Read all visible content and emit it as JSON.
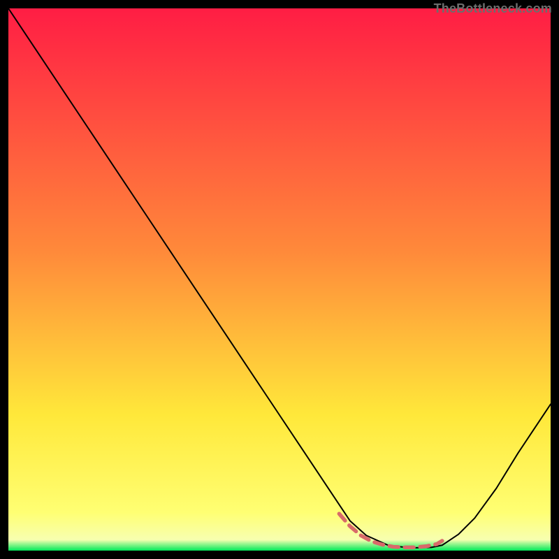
{
  "credit": {
    "text": "TheBottleneck.com"
  },
  "chart_data": {
    "type": "line",
    "title": "",
    "xlabel": "",
    "ylabel": "",
    "xlim": [
      0,
      100
    ],
    "ylim": [
      0,
      100
    ],
    "background_gradient": {
      "stops": [
        {
          "offset": 0.0,
          "color": "#ff1d44"
        },
        {
          "offset": 0.45,
          "color": "#ff8a3a"
        },
        {
          "offset": 0.75,
          "color": "#ffe83a"
        },
        {
          "offset": 0.93,
          "color": "#ffff73"
        },
        {
          "offset": 0.98,
          "color": "#f7ffb0"
        },
        {
          "offset": 1.0,
          "color": "#00e859"
        }
      ]
    },
    "series": [
      {
        "name": "bottleneck-curve",
        "color": "#000000",
        "width": 2,
        "x": [
          0,
          5,
          10,
          15,
          20,
          25,
          30,
          35,
          40,
          45,
          50,
          55,
          60,
          63,
          66,
          70,
          74,
          78,
          80,
          83,
          86,
          90,
          94,
          100
        ],
        "y": [
          100,
          92.5,
          85,
          77.5,
          70,
          62.5,
          55,
          47.5,
          40,
          32.5,
          25,
          17.5,
          10,
          5.5,
          2.8,
          1.0,
          0.5,
          0.6,
          1.0,
          3.0,
          6.0,
          11.5,
          18,
          27
        ]
      }
    ],
    "annotations": [
      {
        "name": "highlight-dashes",
        "kind": "dashed-outline",
        "color": "#d86a6a",
        "width": 5.5,
        "dash": "13 9",
        "x": [
          61,
          63,
          65,
          67,
          69,
          71,
          73,
          75,
          77,
          79,
          80
        ],
        "y": [
          6.8,
          4.5,
          2.8,
          1.7,
          1.1,
          0.7,
          0.6,
          0.6,
          0.8,
          1.2,
          1.8
        ]
      }
    ]
  }
}
